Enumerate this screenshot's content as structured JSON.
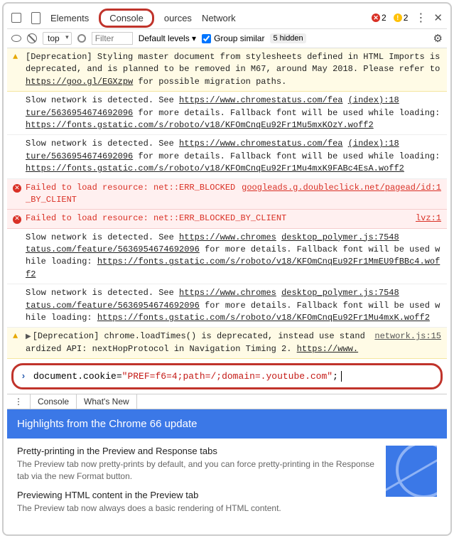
{
  "tabs": {
    "elements": "Elements",
    "console": "Console",
    "sources": "ources",
    "network": "Network"
  },
  "status": {
    "errors": "2",
    "warnings": "2"
  },
  "filterbar": {
    "context": "top",
    "filter_placeholder": "Filter",
    "levels": "Default levels ▾",
    "group": "Group similar",
    "hidden": "5 hidden"
  },
  "logs": [
    {
      "type": "warn",
      "text_parts": [
        "[Deprecation] Styling master document from stylesheets defined in HTML Imports is deprecated, and is planned to be removed in M67, around May 2018. Please refer to ",
        {
          "ul": "https://goo.gl/EGXzpw"
        },
        " for possible migration paths."
      ]
    },
    {
      "type": "info",
      "text_parts": [
        "Slow network is detected. See ",
        {
          "ul": "https://www.chromestatus.com/fea"
        },
        " ",
        {
          "ul": "(index):18"
        },
        "\n",
        {
          "ul": "ture/5636954674692096"
        },
        " for more details. Fallback font will be used while loading: ",
        {
          "ul": "https://fonts.gstatic.com/s/roboto/v18/KFOmCnqEu92Fr1Mu5mxKOzY.woff2"
        }
      ]
    },
    {
      "type": "info",
      "text_parts": [
        "Slow network is detected. See ",
        {
          "ul": "https://www.chromestatus.com/fea"
        },
        " ",
        {
          "ul": "(index):18"
        },
        "\n",
        {
          "ul": "ture/5636954674692096"
        },
        " for more details. Fallback font will be used while loading: ",
        {
          "ul": "https://fonts.gstatic.com/s/roboto/v18/KFOmCnqEu92Fr1Mu4mxK9FABc4EsA.woff2"
        }
      ]
    },
    {
      "type": "err",
      "text": "Failed to load resource: net::ERR_BLOCKED_BY_CLIENT",
      "source": "googleads.g.doubleclick.net/pagead/id:1"
    },
    {
      "type": "err",
      "text": "Failed to load resource: net::ERR_BLOCKED_BY_CLIENT",
      "source": "lvz:1"
    },
    {
      "type": "info",
      "text_parts": [
        "Slow network is detected. See ",
        {
          "ul": "https://www.chromes"
        },
        " ",
        {
          "ul": "desktop_polymer.js:7548"
        },
        "\n",
        {
          "ul": "tatus.com/feature/5636954674692096"
        },
        " for more details. Fallback font will be used while loading: ",
        {
          "ul": "https://fonts.gstatic.com/s/roboto/v18/KFOmCnqEu92Fr1MmEU9fBBc4.woff2"
        }
      ]
    },
    {
      "type": "info",
      "text_parts": [
        "Slow network is detected. See ",
        {
          "ul": "https://www.chromes"
        },
        " ",
        {
          "ul": "desktop_polymer.js:7548"
        },
        "\n",
        {
          "ul": "tatus.com/feature/5636954674692096"
        },
        " for more details. Fallback font will be used while loading: ",
        {
          "ul": "https://fonts.gstatic.com/s/roboto/v18/KFOmCnqEu92Fr1Mu4mxK.woff2"
        }
      ]
    },
    {
      "type": "warn",
      "collapsible": true,
      "text_parts": [
        "[Deprecation] chrome.loadTimes() is deprecated, instead use standardized API: nextHopProtocol in Navigation Timing 2. ",
        {
          "ul": "https://www."
        }
      ],
      "source": "network.js:15"
    }
  ],
  "input": {
    "pre": "document.cookie=",
    "str": "\"PREF=f6=4;path=/;domain=.youtube.com\"",
    "post": ";"
  },
  "drawer": {
    "tab1": "Console",
    "tab2": "What's New"
  },
  "banner": "Highlights from the Chrome 66 update",
  "updates": [
    {
      "title": "Pretty-printing in the Preview and Response tabs",
      "body": "The Preview tab now pretty-prints by default, and you can force pretty-printing in the Response tab via the new Format button."
    },
    {
      "title": "Previewing HTML content in the Preview tab",
      "body": "The Preview tab now always does a basic rendering of HTML content."
    }
  ]
}
